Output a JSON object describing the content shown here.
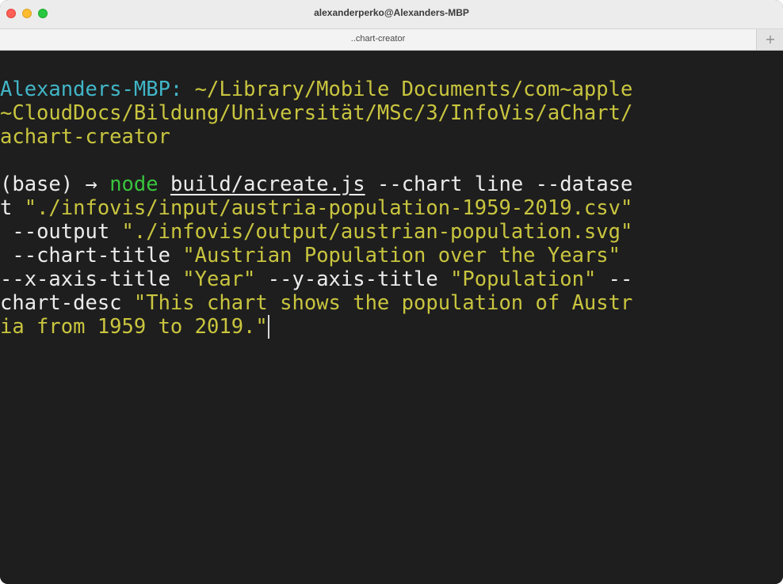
{
  "window": {
    "title": "alexanderperko@Alexanders-MBP"
  },
  "tabs": [
    {
      "label": "..chart-creator"
    }
  ],
  "new_tab_symbol": "+",
  "colors": {
    "prompt": "#41b6c8",
    "path": "#c9c53f",
    "command": "#39c43d",
    "string": "#c9c53f",
    "text": "#ececec",
    "background": "#1e1e1e"
  },
  "terminal": {
    "prompt_host": "Alexanders-MBP:",
    "prompt_path_line1": "~/Library/Mobile Documents/com~apple",
    "prompt_path_line2": "~CloudDocs/Bildung/Universität/MSc/3/InfoVis/aChart/",
    "prompt_path_line3": "achart-creator",
    "env_prefix": "(base)",
    "arrow": "→",
    "command": "node",
    "script_file": "build/acreate.js",
    "flag_chart": "--chart line --datase",
    "flag_chart_wrap": "t",
    "dataset_value": "\"./infovis/input/austria-population-1959-2019.csv\"",
    "flag_output": "--output",
    "output_value": "\"./infovis/output/austrian-population.svg\"",
    "flag_chart_title": "--chart-title",
    "chart_title_value": "\"Austrian Population over the Years\"",
    "flag_x_axis_title": "--x-axis-title",
    "x_axis_title_value": "\"Year\"",
    "flag_y_axis_title": "--y-axis-title",
    "y_axis_title_value": "\"Population\"",
    "flag_chart_desc_part1": "--",
    "flag_chart_desc_part2": "chart-desc",
    "chart_desc_value_line1": "\"This chart shows the population of Austr",
    "chart_desc_value_line2": "ia from 1959 to 2019.\""
  }
}
